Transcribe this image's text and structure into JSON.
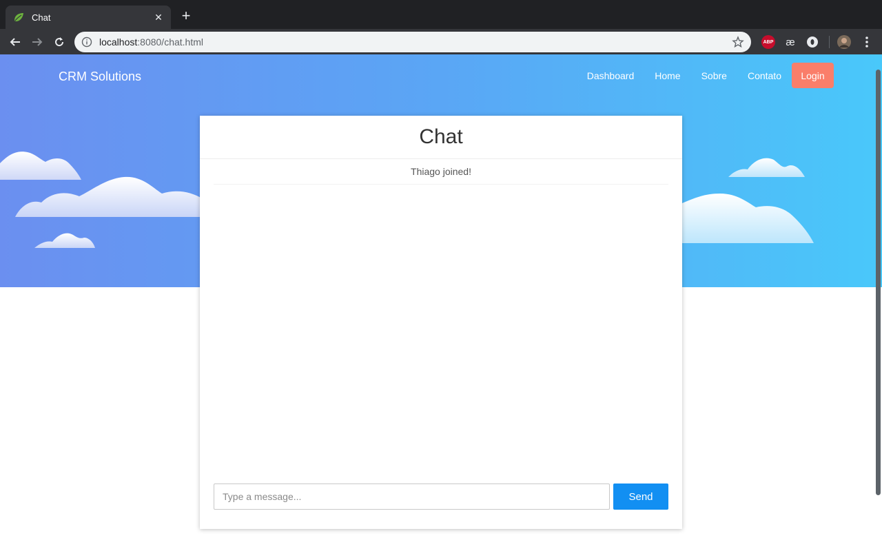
{
  "browser": {
    "tab_title": "Chat",
    "tab_close": "✕",
    "new_tab": "+",
    "url_host": "localhost",
    "url_rest": ":8080/chat.html",
    "extensions": {
      "abp": "ABP",
      "ae": "æ"
    }
  },
  "navbar": {
    "brand": "CRM Solutions",
    "links": [
      "Dashboard",
      "Home",
      "Sobre",
      "Contato"
    ],
    "login": "Login"
  },
  "chat": {
    "title": "Chat",
    "messages": [
      {
        "type": "event",
        "text": "Thiago joined!"
      }
    ],
    "input": {
      "placeholder": "Type a message...",
      "value": ""
    },
    "send_label": "Send"
  },
  "colors": {
    "hero_gradient": [
      "#6b8ff0",
      "#49c8fa"
    ],
    "login_button": "#fa7e6a",
    "send_button": "#128ff2"
  }
}
